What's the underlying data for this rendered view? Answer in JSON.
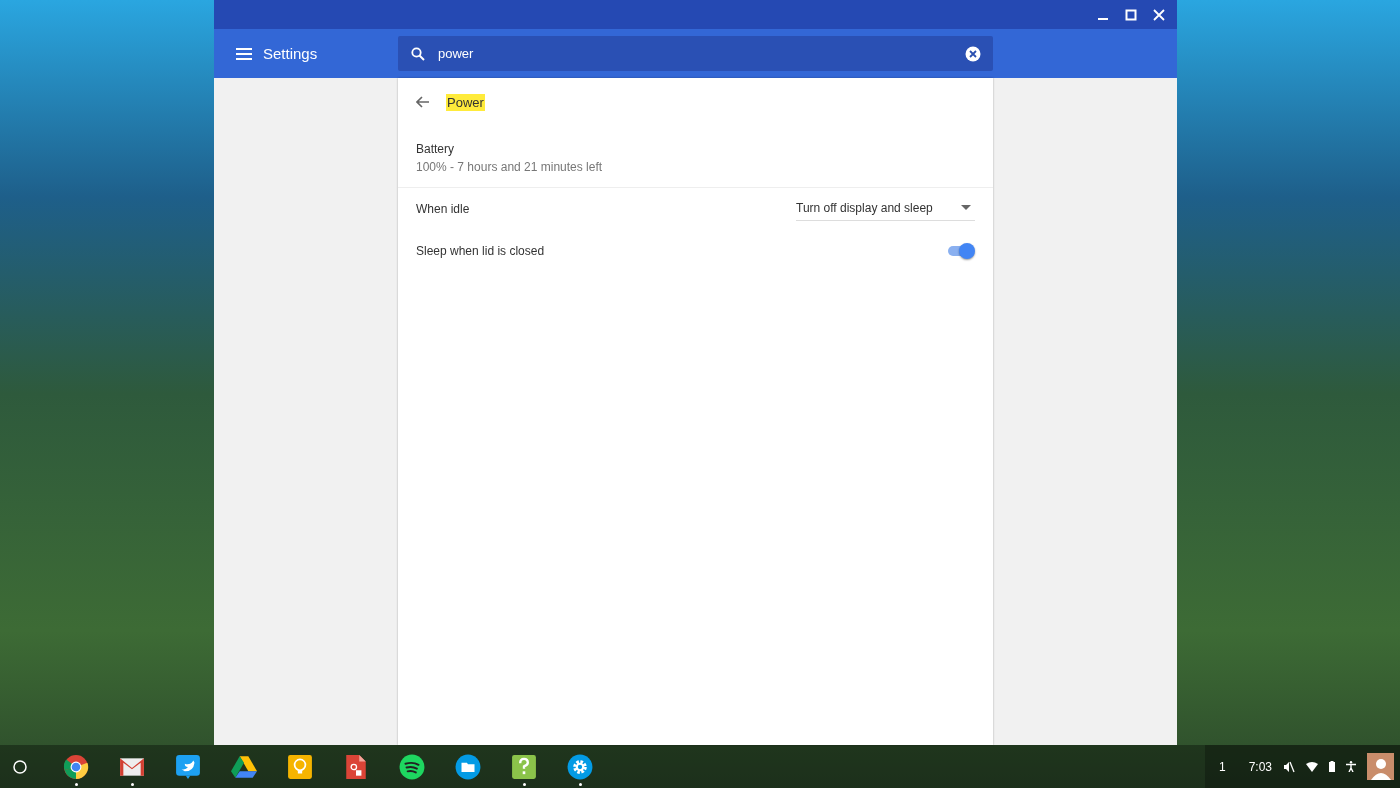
{
  "window": {
    "title": "Settings",
    "search": {
      "value": "power"
    }
  },
  "page": {
    "title": "Power",
    "highlighted": true,
    "battery": {
      "label": "Battery",
      "status": "100% - 7 hours and 21 minutes left"
    },
    "rows": [
      {
        "kind": "dropdown",
        "label": "When idle",
        "value": "Turn off display and sleep"
      },
      {
        "kind": "toggle",
        "label": "Sleep when lid is closed",
        "on": true
      }
    ]
  },
  "shelf": {
    "apps": [
      {
        "kind": "chrome",
        "running": true
      },
      {
        "kind": "gmail",
        "running": true
      },
      {
        "kind": "twitter",
        "running": false
      },
      {
        "kind": "drive",
        "running": false
      },
      {
        "kind": "keep",
        "running": false
      },
      {
        "kind": "doc",
        "running": false
      },
      {
        "kind": "spotify",
        "running": false
      },
      {
        "kind": "files",
        "running": false
      },
      {
        "kind": "help",
        "running": true
      },
      {
        "kind": "settings",
        "running": true
      }
    ],
    "desk": "1",
    "time": "7:03"
  }
}
